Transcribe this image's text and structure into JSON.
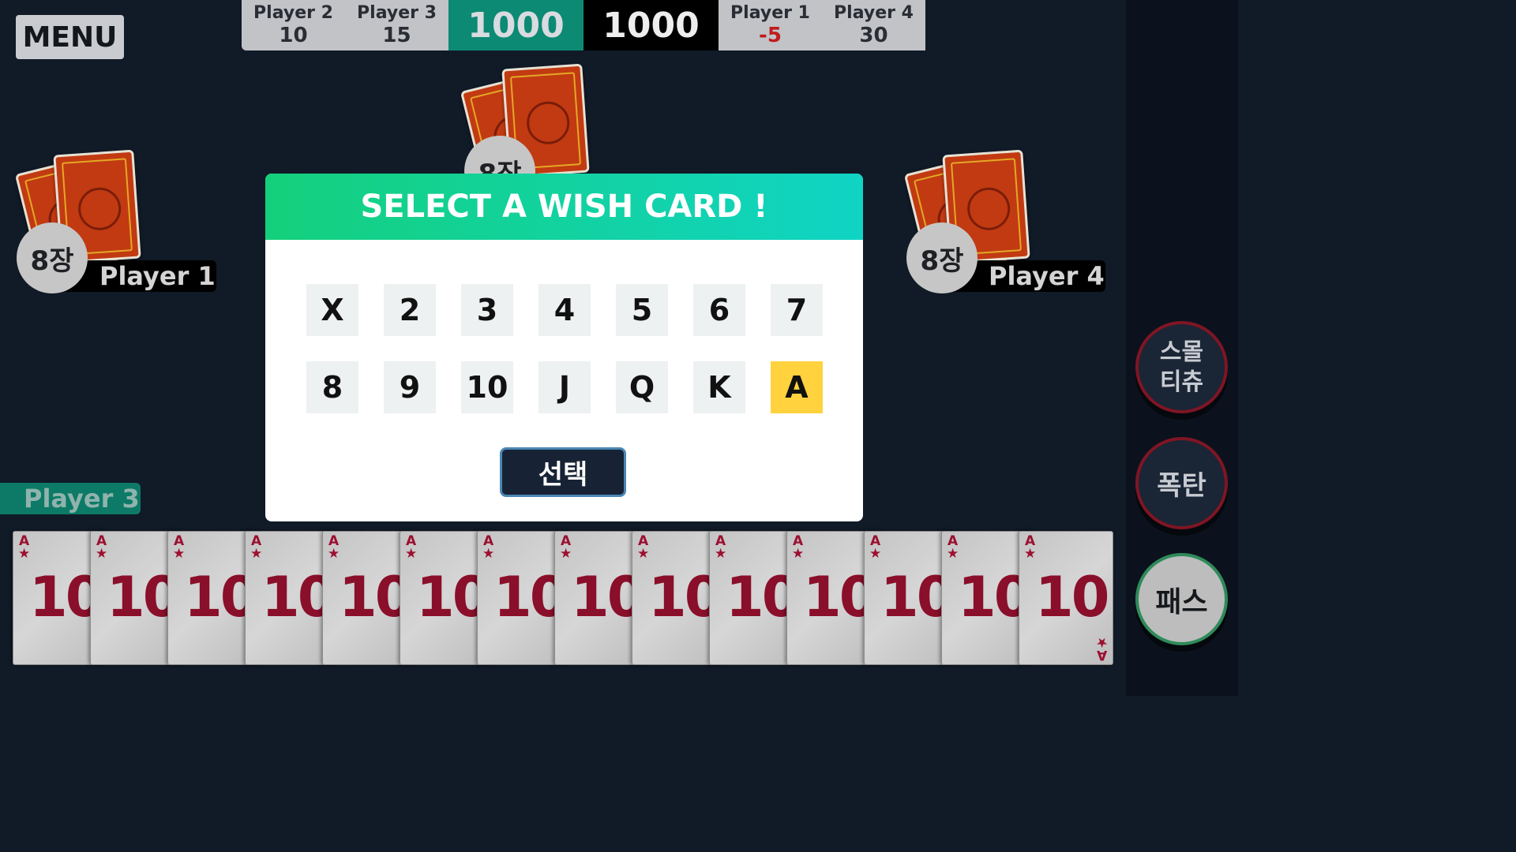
{
  "menu": {
    "label": "MENU"
  },
  "scoreboard": {
    "left": [
      {
        "name": "Player 2",
        "score": "10"
      },
      {
        "name": "Player 3",
        "score": "15"
      }
    ],
    "team_green": "1000",
    "team_black": "1000",
    "right": [
      {
        "name": "Player 1",
        "score": "-5"
      },
      {
        "name": "Player 4",
        "score": "30"
      }
    ]
  },
  "players": {
    "left": {
      "count": "8장",
      "name": "Player 1"
    },
    "right": {
      "count": "8장",
      "name": "Player 4"
    },
    "top": {
      "count": "8장"
    },
    "self": {
      "name": "Player 3"
    }
  },
  "dialog": {
    "title": "SELECT A WISH CARD !",
    "options": [
      "X",
      "2",
      "3",
      "4",
      "5",
      "6",
      "7",
      "8",
      "9",
      "10",
      "J",
      "Q",
      "K",
      "A"
    ],
    "selected": "A",
    "button_label": "선택"
  },
  "hand": {
    "count": 14,
    "card_rank": "10",
    "corner_label": "A",
    "corner_suit": "★"
  },
  "actions": {
    "small_tichu_label": "스몰\n티츄",
    "bomb_label": "폭탄",
    "pass_label": "패스"
  },
  "colors": {
    "accent_green": "#0c8a73",
    "highlight": "#ffd23e",
    "card_red": "#8a0f2a"
  }
}
